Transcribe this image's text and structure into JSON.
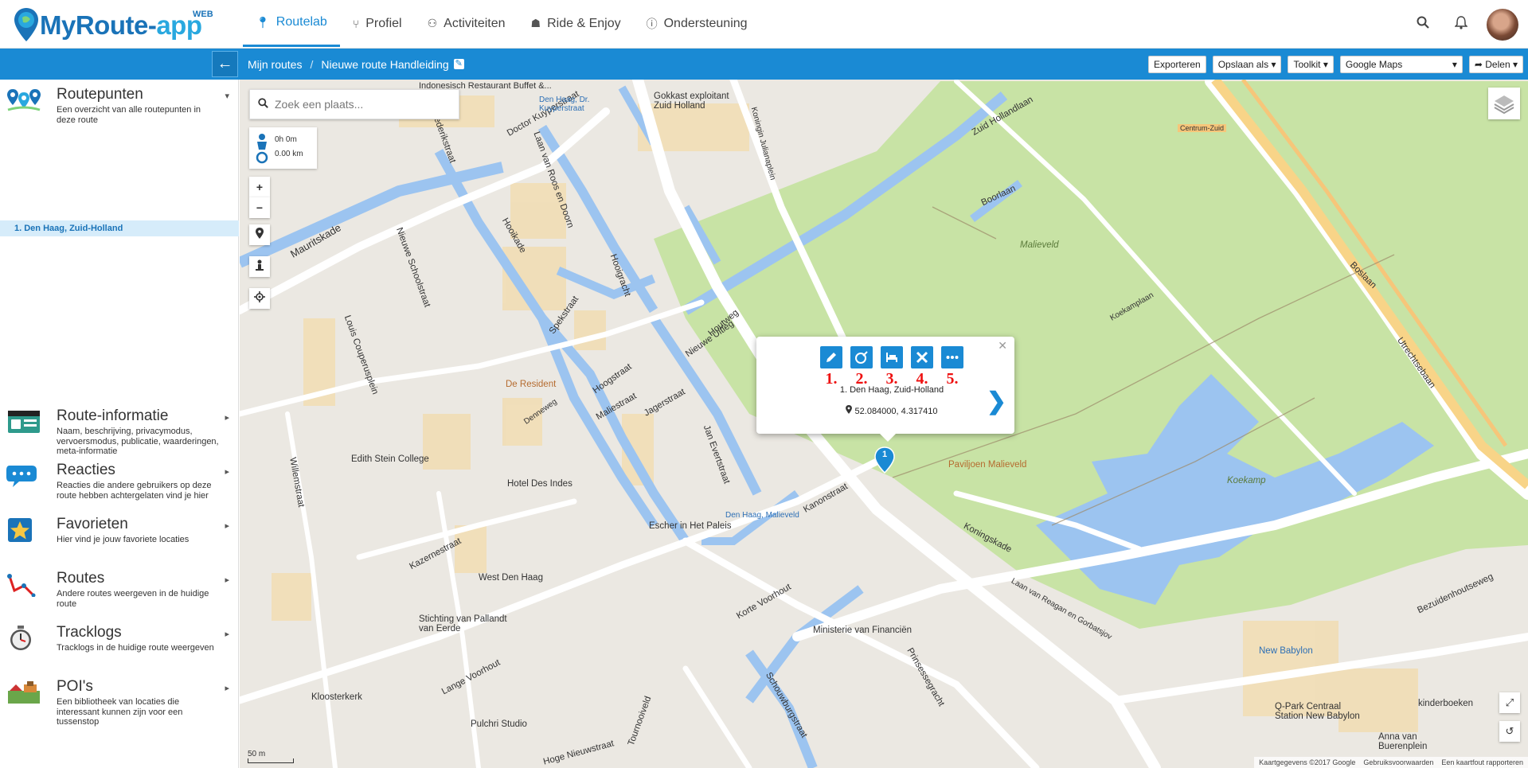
{
  "app": {
    "brand_main": "MyRoute-",
    "brand_accent": "app",
    "badge": "WEB"
  },
  "nav": [
    {
      "label": "Routelab",
      "icon": "pin-icon"
    },
    {
      "label": "Profiel",
      "icon": "share-icon"
    },
    {
      "label": "Activiteiten",
      "icon": "users-icon"
    },
    {
      "label": "Ride & Enjoy",
      "icon": "trophy-icon"
    },
    {
      "label": "Ondersteuning",
      "icon": "info-icon"
    }
  ],
  "breadcrumb": {
    "root": "Mijn routes",
    "separator": "/",
    "current": "Nieuwe route Handleiding"
  },
  "toolbar": {
    "export": "Exporteren",
    "save_as": "Opslaan als",
    "toolkit": "Toolkit",
    "map_provider": "Google Maps",
    "share": "Delen"
  },
  "sidebar": {
    "routepoints": {
      "title": "Routepunten",
      "desc": "Een overzicht van alle routepunten in deze route",
      "items": [
        "1. Den Haag, Zuid-Holland"
      ]
    },
    "sections": [
      {
        "title": "Route-informatie",
        "desc": "Naam, beschrijving, privacymodus, vervoersmodus, publicatie, waarderingen, meta-informatie"
      },
      {
        "title": "Reacties",
        "desc": "Reacties die andere gebruikers op deze route hebben achtergelaten vind je hier"
      },
      {
        "title": "Favorieten",
        "desc": "Hier vind je jouw favoriete locaties"
      },
      {
        "title": "Routes",
        "desc": "Andere routes weergeven in de huidige route"
      },
      {
        "title": "Tracklogs",
        "desc": "Tracklogs in de huidige route weergeven"
      },
      {
        "title": "POI's",
        "desc": "Een bibliotheek van locaties die interessant kunnen zijn voor een tussenstop"
      }
    ]
  },
  "map": {
    "search_placeholder": "Zoek een plaats...",
    "duration": "0h 0m",
    "distance": "0.00 km",
    "zoom_in": "+",
    "zoom_out": "−",
    "scale": "50 m",
    "attribution": [
      "Kaartgegevens ©2017 Google",
      "Gebruiksvoorwaarden",
      "Een kaartfout rapporteren"
    ],
    "labels": [
      "Doctor Kuyperstraat",
      "Den Haag, Dr. Kuyperstraat",
      "Gokkast exploitant Zuid Holland",
      "Zuid Hollandlaan",
      "Boorlaan",
      "Centrum-Zuid",
      "Mauritskade",
      "Frederikstraat",
      "Hooikade",
      "Laan van Roos en Doorn",
      "Malieveld",
      "Boslaan",
      "Utrechtsebaan",
      "Koekamplaan",
      "De Resident",
      "Denneweg",
      "Edith Stein College",
      "Hotel Des Indes",
      "Paviljoen Malieveld",
      "Koekamp",
      "Den Haag, Malieveld",
      "Koningskade",
      "Escher in Het Paleis",
      "West Den Haag",
      "Stichting van Pallandt van Eerde",
      "Ministerie van Financiën",
      "Kloosterkerk",
      "Pulchri Studio",
      "New Babylon",
      "Q-Park Centraal Station New Babylon",
      "kinderboeken",
      "Anna van Buerenplein",
      "Bezuidenhoutseweg",
      "Laan van Reagan en Gorbatsjov",
      "Kazernestraat",
      "Lange Voorhout",
      "Korte Voorhout",
      "Nieuwe Uitleg",
      "Jan Evertstraat",
      "Hoogstraat",
      "Maliestraat",
      "Prinsessegracht",
      "Schouwburgstraat",
      "Willemstraat",
      "Nieuwe Schoolstraat",
      "Louis Couperusplein",
      "Spekstraat",
      "Hooigracht",
      "Jagerstraat",
      "Kanonstraat",
      "Hoge Nieuwstraat",
      "Tournooiveld",
      "Indonesisch Restaurant Buffet &...",
      "Houtweg",
      "Koningin Julianaplein"
    ]
  },
  "popup": {
    "actions": [
      {
        "num": "1.",
        "icon": "edit-icon"
      },
      {
        "num": "2.",
        "icon": "search-nearby-icon"
      },
      {
        "num": "3.",
        "icon": "hotel-icon"
      },
      {
        "num": "4.",
        "icon": "delete-icon"
      },
      {
        "num": "5.",
        "icon": "more-icon"
      }
    ],
    "name": "1. Den Haag, Zuid-Holland",
    "coords": "52.084000, 4.317410",
    "marker": "1"
  },
  "colors": {
    "accent": "#1a8ad4",
    "park": "#c8e3a5",
    "water": "#9cc4f0"
  }
}
